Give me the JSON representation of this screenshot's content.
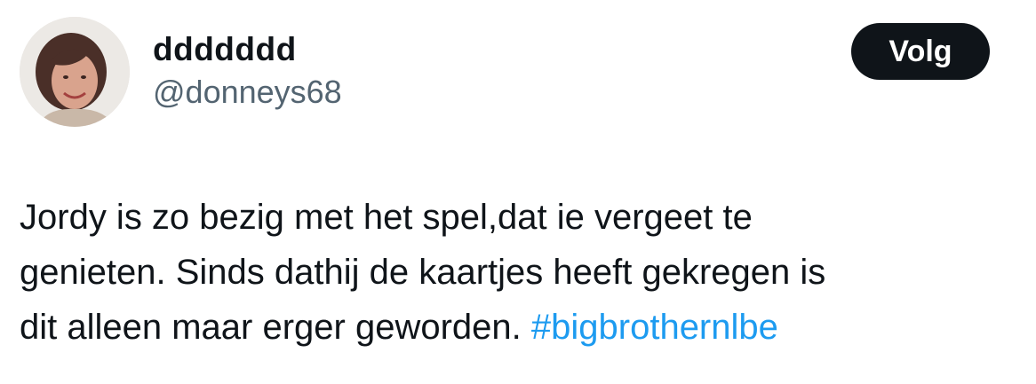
{
  "author": {
    "display_name": "ddddddd",
    "handle": "@donneys68"
  },
  "actions": {
    "follow_label": "Volg"
  },
  "tweet": {
    "line1": "Jordy is zo bezig met het spel,dat ie vergeet te",
    "line2": "genieten. Sinds dathij de kaartjes heeft gekregen is",
    "line3_text": "dit alleen maar erger geworden. ",
    "hashtag": "#bigbrothernlbe"
  },
  "colors": {
    "text": "#0f1419",
    "secondary": "#536471",
    "link": "#1d9bf0",
    "button_bg": "#0f1419"
  }
}
